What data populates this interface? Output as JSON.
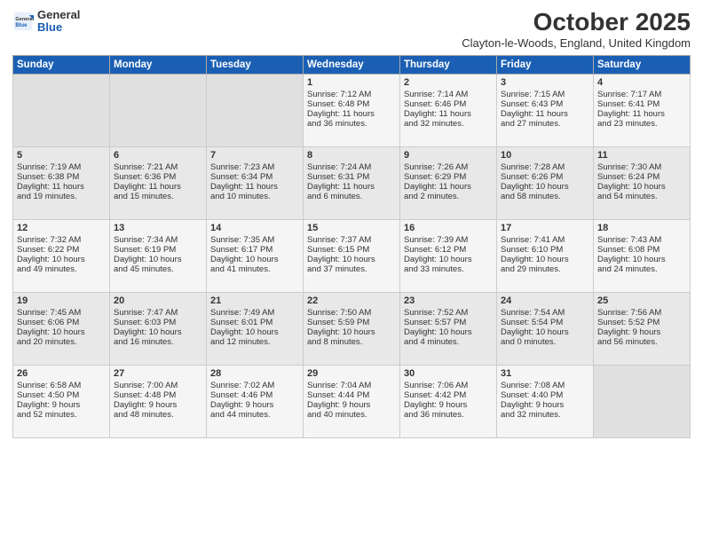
{
  "header": {
    "logo_general": "General",
    "logo_blue": "Blue",
    "month": "October 2025",
    "location": "Clayton-le-Woods, England, United Kingdom"
  },
  "days_of_week": [
    "Sunday",
    "Monday",
    "Tuesday",
    "Wednesday",
    "Thursday",
    "Friday",
    "Saturday"
  ],
  "weeks": [
    [
      {
        "day": "",
        "content": ""
      },
      {
        "day": "",
        "content": ""
      },
      {
        "day": "",
        "content": ""
      },
      {
        "day": "1",
        "content": "Sunrise: 7:12 AM\nSunset: 6:48 PM\nDaylight: 11 hours\nand 36 minutes."
      },
      {
        "day": "2",
        "content": "Sunrise: 7:14 AM\nSunset: 6:46 PM\nDaylight: 11 hours\nand 32 minutes."
      },
      {
        "day": "3",
        "content": "Sunrise: 7:15 AM\nSunset: 6:43 PM\nDaylight: 11 hours\nand 27 minutes."
      },
      {
        "day": "4",
        "content": "Sunrise: 7:17 AM\nSunset: 6:41 PM\nDaylight: 11 hours\nand 23 minutes."
      }
    ],
    [
      {
        "day": "5",
        "content": "Sunrise: 7:19 AM\nSunset: 6:38 PM\nDaylight: 11 hours\nand 19 minutes."
      },
      {
        "day": "6",
        "content": "Sunrise: 7:21 AM\nSunset: 6:36 PM\nDaylight: 11 hours\nand 15 minutes."
      },
      {
        "day": "7",
        "content": "Sunrise: 7:23 AM\nSunset: 6:34 PM\nDaylight: 11 hours\nand 10 minutes."
      },
      {
        "day": "8",
        "content": "Sunrise: 7:24 AM\nSunset: 6:31 PM\nDaylight: 11 hours\nand 6 minutes."
      },
      {
        "day": "9",
        "content": "Sunrise: 7:26 AM\nSunset: 6:29 PM\nDaylight: 11 hours\nand 2 minutes."
      },
      {
        "day": "10",
        "content": "Sunrise: 7:28 AM\nSunset: 6:26 PM\nDaylight: 10 hours\nand 58 minutes."
      },
      {
        "day": "11",
        "content": "Sunrise: 7:30 AM\nSunset: 6:24 PM\nDaylight: 10 hours\nand 54 minutes."
      }
    ],
    [
      {
        "day": "12",
        "content": "Sunrise: 7:32 AM\nSunset: 6:22 PM\nDaylight: 10 hours\nand 49 minutes."
      },
      {
        "day": "13",
        "content": "Sunrise: 7:34 AM\nSunset: 6:19 PM\nDaylight: 10 hours\nand 45 minutes."
      },
      {
        "day": "14",
        "content": "Sunrise: 7:35 AM\nSunset: 6:17 PM\nDaylight: 10 hours\nand 41 minutes."
      },
      {
        "day": "15",
        "content": "Sunrise: 7:37 AM\nSunset: 6:15 PM\nDaylight: 10 hours\nand 37 minutes."
      },
      {
        "day": "16",
        "content": "Sunrise: 7:39 AM\nSunset: 6:12 PM\nDaylight: 10 hours\nand 33 minutes."
      },
      {
        "day": "17",
        "content": "Sunrise: 7:41 AM\nSunset: 6:10 PM\nDaylight: 10 hours\nand 29 minutes."
      },
      {
        "day": "18",
        "content": "Sunrise: 7:43 AM\nSunset: 6:08 PM\nDaylight: 10 hours\nand 24 minutes."
      }
    ],
    [
      {
        "day": "19",
        "content": "Sunrise: 7:45 AM\nSunset: 6:06 PM\nDaylight: 10 hours\nand 20 minutes."
      },
      {
        "day": "20",
        "content": "Sunrise: 7:47 AM\nSunset: 6:03 PM\nDaylight: 10 hours\nand 16 minutes."
      },
      {
        "day": "21",
        "content": "Sunrise: 7:49 AM\nSunset: 6:01 PM\nDaylight: 10 hours\nand 12 minutes."
      },
      {
        "day": "22",
        "content": "Sunrise: 7:50 AM\nSunset: 5:59 PM\nDaylight: 10 hours\nand 8 minutes."
      },
      {
        "day": "23",
        "content": "Sunrise: 7:52 AM\nSunset: 5:57 PM\nDaylight: 10 hours\nand 4 minutes."
      },
      {
        "day": "24",
        "content": "Sunrise: 7:54 AM\nSunset: 5:54 PM\nDaylight: 10 hours\nand 0 minutes."
      },
      {
        "day": "25",
        "content": "Sunrise: 7:56 AM\nSunset: 5:52 PM\nDaylight: 9 hours\nand 56 minutes."
      }
    ],
    [
      {
        "day": "26",
        "content": "Sunrise: 6:58 AM\nSunset: 4:50 PM\nDaylight: 9 hours\nand 52 minutes."
      },
      {
        "day": "27",
        "content": "Sunrise: 7:00 AM\nSunset: 4:48 PM\nDaylight: 9 hours\nand 48 minutes."
      },
      {
        "day": "28",
        "content": "Sunrise: 7:02 AM\nSunset: 4:46 PM\nDaylight: 9 hours\nand 44 minutes."
      },
      {
        "day": "29",
        "content": "Sunrise: 7:04 AM\nSunset: 4:44 PM\nDaylight: 9 hours\nand 40 minutes."
      },
      {
        "day": "30",
        "content": "Sunrise: 7:06 AM\nSunset: 4:42 PM\nDaylight: 9 hours\nand 36 minutes."
      },
      {
        "day": "31",
        "content": "Sunrise: 7:08 AM\nSunset: 4:40 PM\nDaylight: 9 hours\nand 32 minutes."
      },
      {
        "day": "",
        "content": ""
      }
    ]
  ]
}
